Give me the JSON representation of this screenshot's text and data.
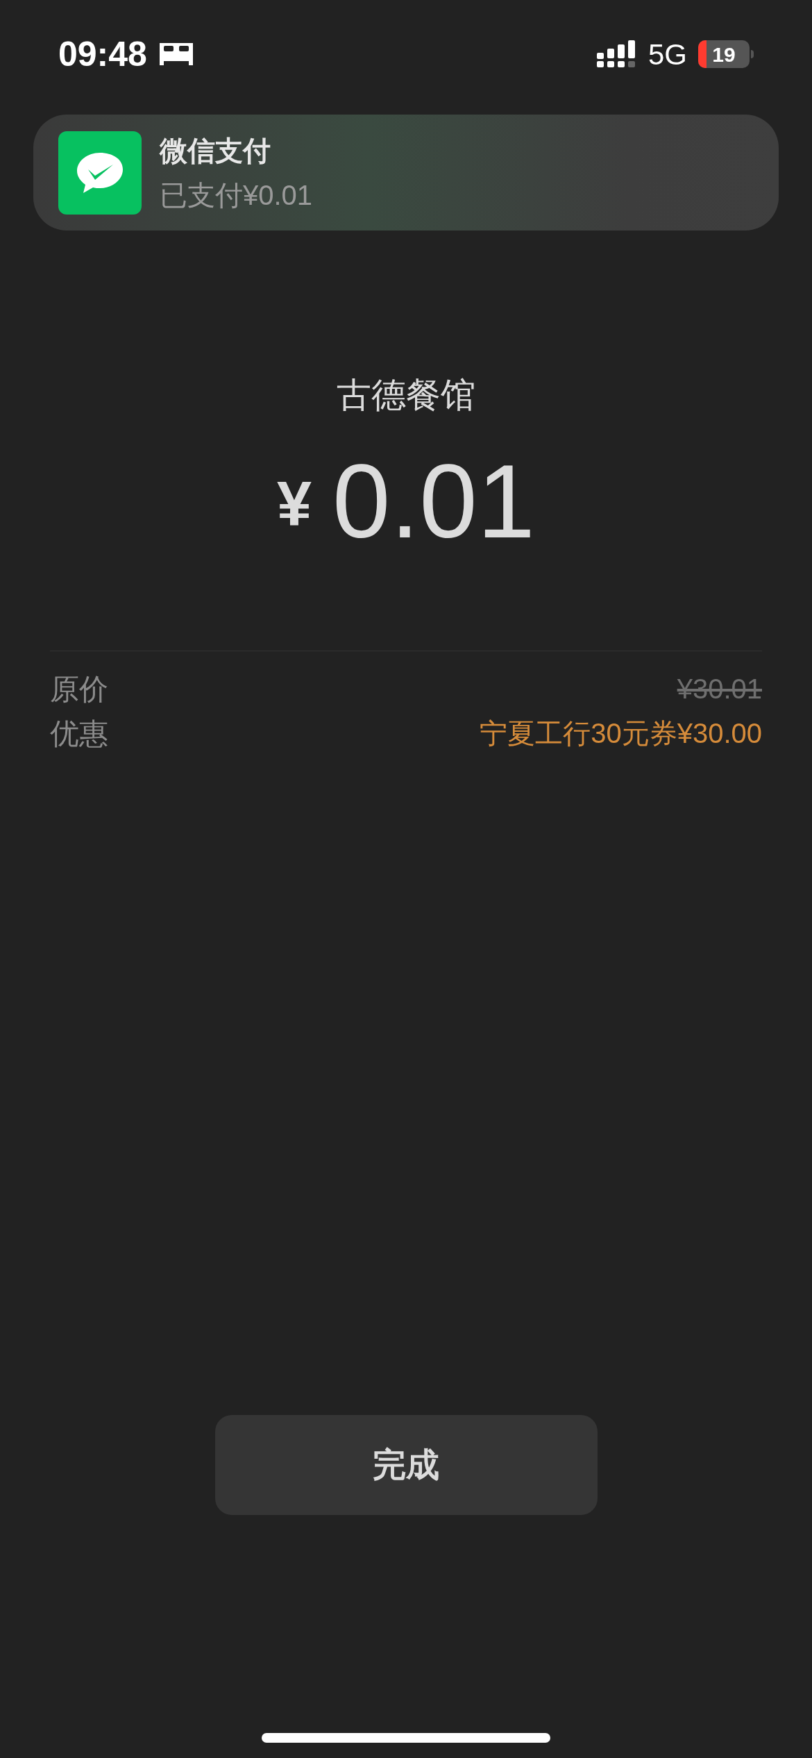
{
  "status_bar": {
    "time": "09:48",
    "network": "5G",
    "battery": "19"
  },
  "notification": {
    "app": "微信支付",
    "message": "已支付¥0.01"
  },
  "merchant": "古德餐馆",
  "amount": {
    "currency": "¥",
    "value": "0.01"
  },
  "details": [
    {
      "label": "原价",
      "value": "¥30.01",
      "kind": "original"
    },
    {
      "label": "优惠",
      "value": "宁夏工行30元券¥30.00",
      "kind": "discount"
    }
  ],
  "button": "完成"
}
